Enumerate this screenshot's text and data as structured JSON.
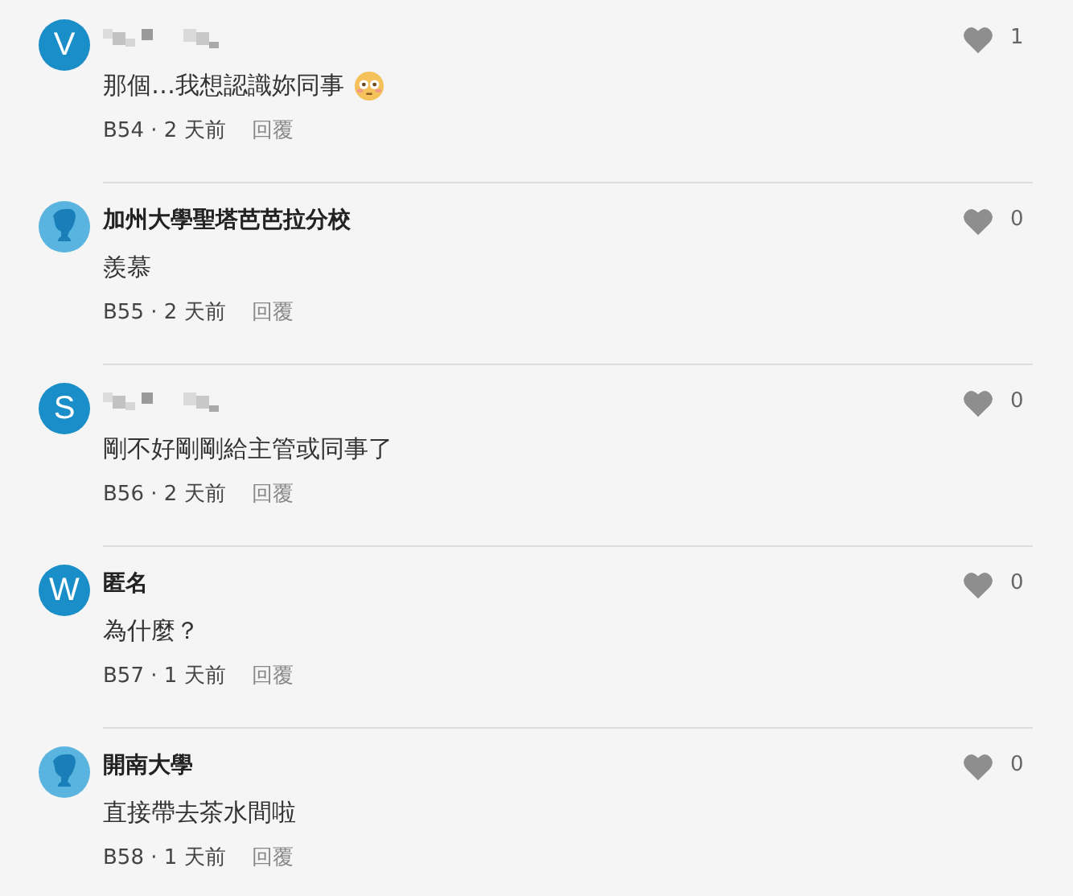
{
  "comments": [
    {
      "avatar": {
        "kind": "letter",
        "letter": "V"
      },
      "name_hidden": true,
      "content": "那個…我想認識妳同事",
      "emoji": {
        "kind": "flushed"
      },
      "meta": "B54 · 2 天前",
      "reply": "回覆",
      "likes": "1"
    },
    {
      "avatar": {
        "kind": "silhouette"
      },
      "name": "加州大學聖塔芭芭拉分校",
      "content": "羨慕",
      "meta": "B55 · 2 天前",
      "reply": "回覆",
      "likes": "0"
    },
    {
      "avatar": {
        "kind": "letter",
        "letter": "S"
      },
      "name_hidden": true,
      "content": "剛不好剛剛給主管或同事了",
      "meta": "B56 · 2 天前",
      "reply": "回覆",
      "likes": "0"
    },
    {
      "avatar": {
        "kind": "letter",
        "letter": "W"
      },
      "name": "匿名",
      "content": "為什麼？",
      "meta": "B57 · 1 天前",
      "reply": "回覆",
      "likes": "0"
    },
    {
      "avatar": {
        "kind": "silhouette"
      },
      "name": "開南大學",
      "content": "直接帶去茶水間啦",
      "meta": "B58 · 1 天前",
      "reply": "回覆",
      "likes": "0"
    }
  ]
}
